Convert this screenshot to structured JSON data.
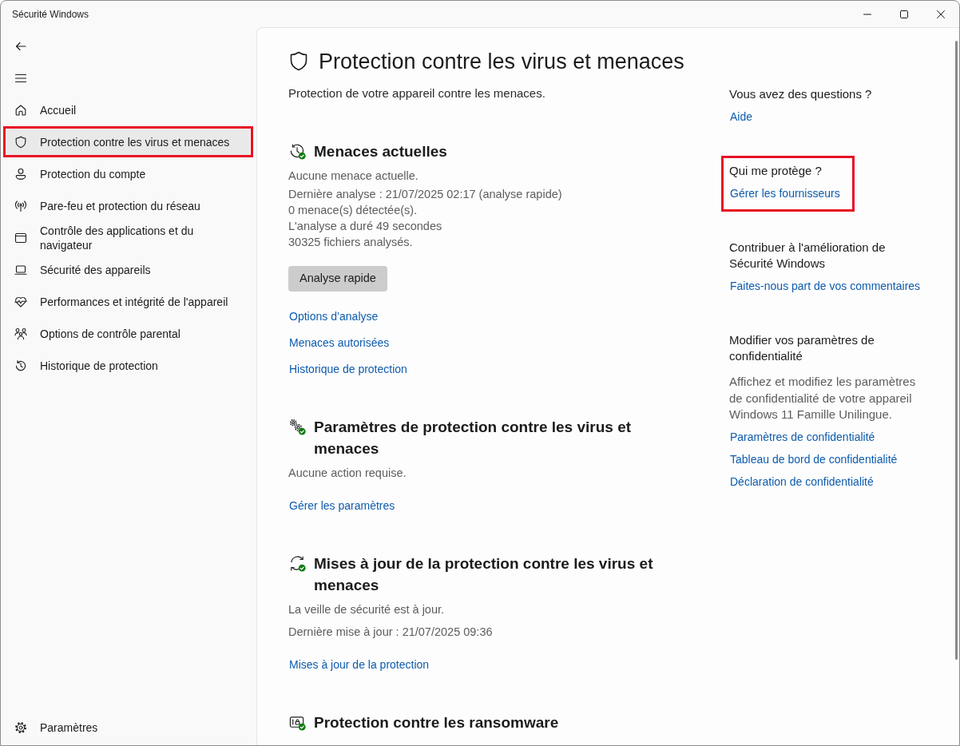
{
  "window": {
    "title": "Sécurité Windows"
  },
  "sidebar": {
    "items": [
      {
        "label": "Accueil",
        "selected": false,
        "highlighted": false
      },
      {
        "label": "Protection contre les virus et menaces",
        "selected": true,
        "highlighted": true
      },
      {
        "label": "Protection du compte",
        "selected": false,
        "highlighted": false
      },
      {
        "label": "Pare-feu et protection du réseau",
        "selected": false,
        "highlighted": false
      },
      {
        "label": "Contrôle des applications et du navigateur",
        "selected": false,
        "highlighted": false
      },
      {
        "label": "Sécurité des appareils",
        "selected": false,
        "highlighted": false
      },
      {
        "label": "Performances et intégrité de l'appareil",
        "selected": false,
        "highlighted": false
      },
      {
        "label": "Options de contrôle parental",
        "selected": false,
        "highlighted": false
      },
      {
        "label": "Historique de protection",
        "selected": false,
        "highlighted": false
      }
    ],
    "settings_item": {
      "label": "Paramètres"
    }
  },
  "page": {
    "title": "Protection contre les virus et menaces",
    "subtitle": "Protection de votre appareil contre les menaces.",
    "sections": [
      {
        "title": "Menaces actuelles",
        "lines": [
          "Aucune menace actuelle."
        ],
        "details": [
          "Dernière analyse : 21/07/2025 02:17 (analyse rapide)",
          "0 menace(s) détectée(s).",
          "L'analyse a duré 49 secondes",
          "30325 fichiers analysés."
        ],
        "button": "Analyse rapide",
        "links": [
          "Options d’analyse",
          "Menaces autorisées",
          "Historique de protection"
        ]
      },
      {
        "title": "Paramètres de protection contre les virus et menaces",
        "lines": [
          "Aucune action requise."
        ],
        "links": [
          "Gérer les paramètres"
        ]
      },
      {
        "title": "Mises à jour de la protection contre les virus et menaces",
        "lines": [
          "La veille de sécurité est à jour.",
          "Dernière mise à jour : 21/07/2025 09:36"
        ],
        "links": [
          "Mises à jour de la protection"
        ]
      },
      {
        "title": "Protection contre les ransomware"
      }
    ]
  },
  "side_panel": {
    "sections": [
      {
        "heading": "Vous avez des questions ?",
        "links": [
          "Aide"
        ],
        "highlighted": false
      },
      {
        "heading": "Qui me protège ?",
        "links": [
          "Gérer les fournisseurs"
        ],
        "highlighted": true
      },
      {
        "heading": "Contribuer à l'amélioration de Sécurité Windows",
        "links": [
          "Faites-nous part de vos commentaires"
        ],
        "highlighted": false
      },
      {
        "heading": "Modifier vos paramètres de confidentialité",
        "text": "Affichez et modifiez les paramètres de confidentialité de votre appareil Windows 11 Famille Unilingue.",
        "links": [
          "Paramètres de confidentialité",
          "Tableau de bord de confidentialité",
          "Déclaration de confidentialité"
        ],
        "highlighted": false
      }
    ]
  }
}
